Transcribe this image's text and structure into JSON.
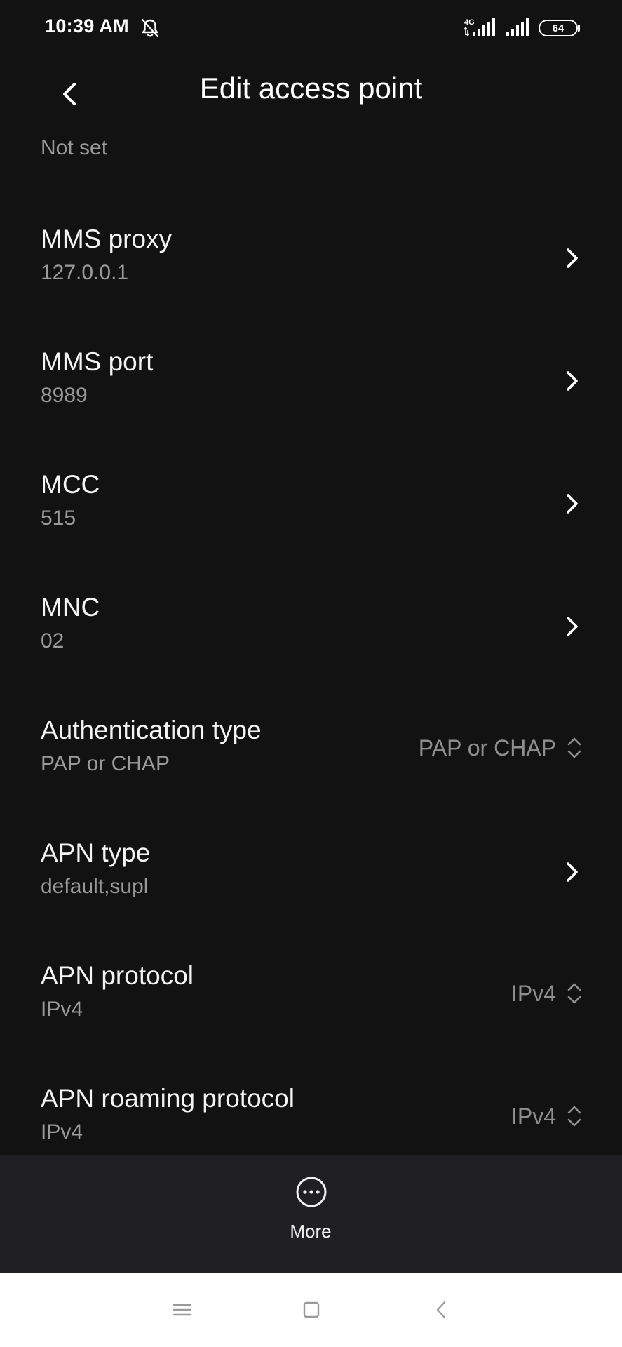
{
  "status_bar": {
    "time": "10:39 AM",
    "network": "4G",
    "battery": "64"
  },
  "header": {
    "title": "Edit access point"
  },
  "partial_row": {
    "value": "Not set"
  },
  "rows": [
    {
      "title": "MMS proxy",
      "value": "127.0.0.1",
      "control": "chevron"
    },
    {
      "title": "MMS port",
      "value": "8989",
      "control": "chevron"
    },
    {
      "title": "MCC",
      "value": "515",
      "control": "chevron"
    },
    {
      "title": "MNC",
      "value": "02",
      "control": "chevron"
    },
    {
      "title": "Authentication type",
      "value": "PAP or CHAP",
      "control": "select",
      "selected": "PAP or CHAP"
    },
    {
      "title": "APN type",
      "value": "default,supl",
      "control": "chevron"
    },
    {
      "title": "APN protocol",
      "value": "IPv4",
      "control": "select",
      "selected": "IPv4"
    },
    {
      "title": "APN roaming protocol",
      "value": "IPv4",
      "control": "select",
      "selected": "IPv4"
    }
  ],
  "bottom_bar": {
    "more_label": "More"
  },
  "icons": {
    "back": "chevron-left-icon",
    "mute": "bell-off-icon",
    "row_chevron": "chevron-right-icon",
    "select": "up-down-icon",
    "more": "more-horizontal-icon",
    "nav_menu": "menu-icon",
    "nav_home": "home-square-icon",
    "nav_back": "back-triangle-icon"
  },
  "colors": {
    "background": "#121212",
    "bottom_bar": "#1f1f24",
    "text_primary": "#f4f4f4",
    "text_secondary": "#9a9a9a",
    "nav_background": "#ffffff"
  }
}
